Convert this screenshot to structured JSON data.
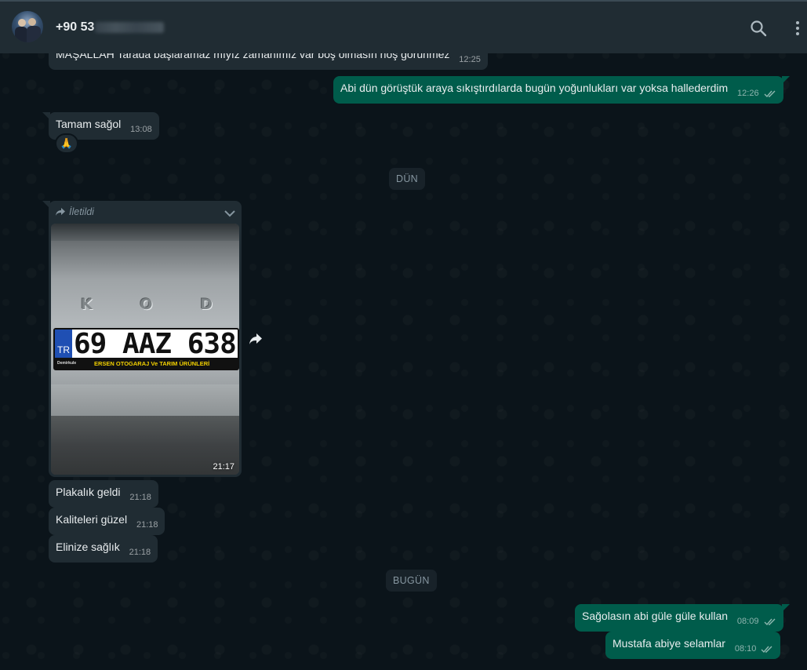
{
  "header": {
    "contact_name": "+90 53",
    "search_icon": "search-icon",
    "menu_icon": "menu-dots-icon"
  },
  "messages": [
    {
      "id": "m0",
      "dir": "in",
      "text": "MAŞALLAH  Tarada başlaramaz mıyız  zamanımız var boş olmasın hoş görünmez",
      "time": "12:25"
    },
    {
      "id": "m1",
      "dir": "out",
      "text": "Abi dün görüştük araya sıkıştırdılarda bugün yoğunlukları var yoksa hallederdim",
      "time": "12:26"
    },
    {
      "id": "m2",
      "dir": "in",
      "text": "Tamam sağol",
      "time": "13:08",
      "reaction": "🙏"
    },
    {
      "id": "m3",
      "dir": "in",
      "forwarded_label": "İletildi",
      "time": "21:17",
      "image": {
        "plate_country": "TR",
        "plate_number": "69 AAZ 638",
        "dealer_strip": "ERSEN OTOGARAJ Ve TARIM ÜRÜNLERİ",
        "car_badge": [
          "K",
          "O",
          "D"
        ],
        "strip_small": "Demirkule"
      }
    },
    {
      "id": "m4",
      "dir": "in",
      "text": "Plakalık  geldi",
      "time": "21:18"
    },
    {
      "id": "m5",
      "dir": "in",
      "text": "Kaliteleri güzel",
      "time": "21:18"
    },
    {
      "id": "m6",
      "dir": "in",
      "text": "Elinize sağlık",
      "time": "21:18"
    },
    {
      "id": "m7",
      "dir": "out",
      "text": "Sağolasın abi güle güle kullan",
      "time": "08:09"
    },
    {
      "id": "m8",
      "dir": "out",
      "text": "Mustafa abiye selamlar",
      "time": "08:10"
    }
  ],
  "date_chips": {
    "yesterday": "DÜN",
    "today": "BUGÜN"
  },
  "colors": {
    "incoming": "#202c33",
    "outgoing": "#005c4b",
    "background": "#0b141a",
    "header": "#202c33",
    "read_ticks": "#8fb8b0"
  }
}
